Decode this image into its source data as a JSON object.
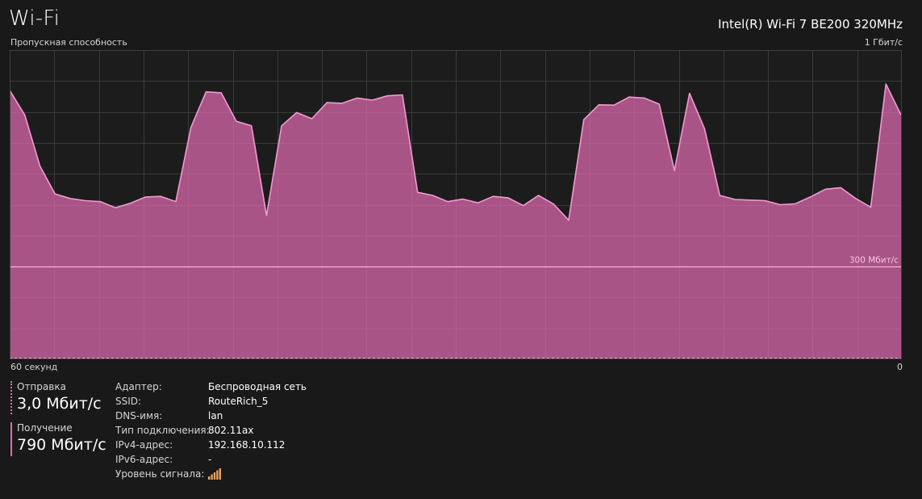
{
  "header": {
    "title": "Wi-Fi",
    "adapter": "Intel(R) Wi-Fi 7 BE200 320MHz"
  },
  "chart_data": {
    "type": "area",
    "title": "Пропускная способность",
    "y_max_label": "1 Гбит/с",
    "x_left_label": "60 секунд",
    "x_right_label": "0",
    "ylim": [
      0,
      1000
    ],
    "y_unit": "Мбит/с",
    "grid": true,
    "reference_line": {
      "value": 300,
      "label": "300 Мбит/с"
    },
    "color": "#e06bb0",
    "series": [
      {
        "values": [
          870,
          790,
          625,
          535,
          520,
          513,
          510,
          490,
          505,
          525,
          527,
          510,
          750,
          865,
          862,
          770,
          755,
          465,
          755,
          798,
          778,
          830,
          828,
          845,
          838,
          852,
          855,
          540,
          530,
          510,
          518,
          506,
          527,
          522,
          497,
          530,
          502,
          450,
          775,
          823,
          822,
          848,
          845,
          825,
          610,
          860,
          745,
          530,
          517,
          515,
          513,
          500,
          503,
          525,
          550,
          555,
          520,
          492,
          890,
          790
        ]
      }
    ]
  },
  "stats": {
    "send": {
      "label": "Отправка",
      "value": "3,0 Мбит/с"
    },
    "receive": {
      "label": "Получение",
      "value": "790 Мбит/с"
    }
  },
  "properties": [
    {
      "key": "Адаптер:",
      "value": "Беспроводная сеть"
    },
    {
      "key": "SSID:",
      "value": "RouteRich_5"
    },
    {
      "key": "DNS-имя:",
      "value": "lan"
    },
    {
      "key": "Тип подключения:",
      "value": "802.11ax"
    },
    {
      "key": "IPv4-адрес:",
      "value": "192.168.10.112"
    },
    {
      "key": "IPv6-адрес:",
      "value": "-"
    },
    {
      "key": "Уровень сигнала:",
      "value": ""
    }
  ],
  "signal": {
    "icon": "signal-strength-icon",
    "color": "#e8a05c"
  }
}
